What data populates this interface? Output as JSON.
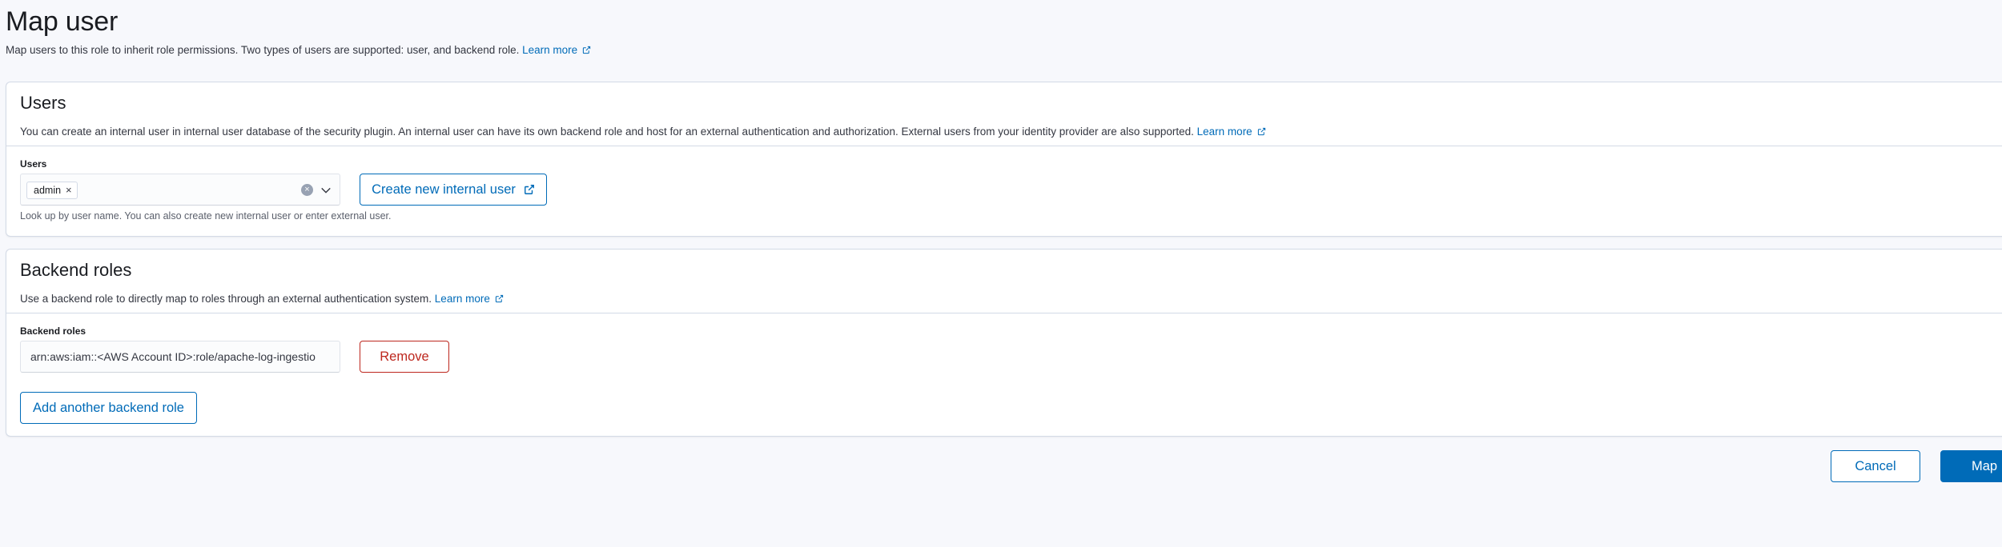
{
  "page": {
    "title": "Map user",
    "description": "Map users to this role to inherit role permissions. Two types of users are supported: user, and backend role.",
    "learn_more": "Learn more"
  },
  "users_panel": {
    "title": "Users",
    "description": "You can create an internal user in internal user database of the security plugin. An internal user can have its own backend role and host for an external authentication and authorization. External users from your identity provider are also supported.",
    "learn_more": "Learn more",
    "field_label": "Users",
    "selected": [
      {
        "label": "admin"
      }
    ],
    "help_text": "Look up by user name. You can also create new internal user or enter external user.",
    "create_button": "Create new internal user"
  },
  "backend_panel": {
    "title": "Backend roles",
    "description": "Use a backend role to directly map to roles through an external authentication system.",
    "learn_more": "Learn more",
    "field_label": "Backend roles",
    "role_value": "arn:aws:iam::<AWS Account ID>:role/apache-log-ingestio",
    "remove_button": "Remove",
    "add_button": "Add another backend role"
  },
  "footer": {
    "cancel_button": "Cancel",
    "map_button": "Map"
  },
  "colors": {
    "accent": "#006bb8",
    "danger": "#bd271e",
    "background": "#f7f8fc"
  },
  "icons": {
    "external_link": "external-link-icon",
    "clear": "clear-icon",
    "dropdown": "chevron-down-icon",
    "remove_chip": "close-icon"
  }
}
